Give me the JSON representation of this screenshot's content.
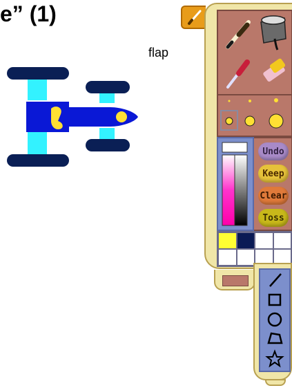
{
  "title": "e” (1)",
  "callout": {
    "label": "flap"
  },
  "tools": [
    {
      "icon": "paintbrush-icon"
    },
    {
      "icon": "paint-bucket-icon"
    },
    {
      "icon": "eyedropper-icon"
    },
    {
      "icon": "eraser-icon"
    }
  ],
  "buttons": {
    "undo": "Undo",
    "keep": "Keep",
    "clear": "Clear",
    "toss": "Toss"
  },
  "brush_sizes": 4,
  "swatches": {
    "colors": [
      "#ffff33",
      "#0a1a55",
      "#ffffff",
      "#ffffff",
      "#ffffff",
      "#ffffff",
      "#ffffff",
      "#ffffff"
    ]
  },
  "shapes": [
    "line-icon",
    "rectangle-icon",
    "ellipse-icon",
    "polygon-icon",
    "star-icon"
  ],
  "colors": {
    "palette_frame": "#f0e6a8",
    "tool_panel": "#b9786a",
    "color_panel": "#7c8fcc",
    "flap_tab": "#e89c1a",
    "car_body": "#0a18d6",
    "car_wheels": "#0a1f55",
    "car_axle": "#33f2ff",
    "car_accent": "#ffe033"
  }
}
